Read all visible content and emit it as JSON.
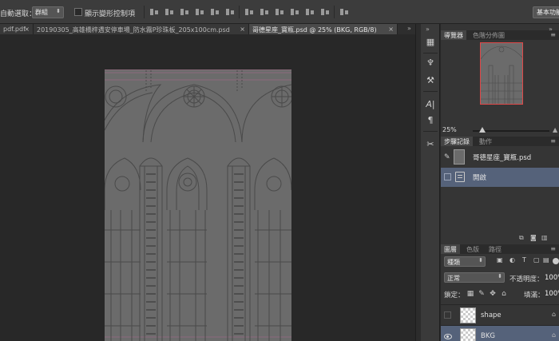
{
  "options_bar": {
    "auto_select_label": "自動選取：",
    "auto_select_value": "群組",
    "show_transform_label": "顯示變形控制項",
    "workspace_value": "基本功能"
  },
  "doc_tabs": [
    {
      "label": "pdf.pdf",
      "active": false
    },
    {
      "label": "20190305_高雄橋梓遇安停車場_防水霧P珍珠板_205x100cm.psd",
      "active": false
    },
    {
      "label": "哥德星座_寶瓶.psd @ 25% (BKG, RGB/8)",
      "active": true
    }
  ],
  "icons": {
    "close": "×",
    "collapse": "»",
    "dropdown": "⬍",
    "panel_menu": "≡"
  },
  "navigator": {
    "tabs": [
      "導覽器",
      "色階分佈圖"
    ],
    "zoom": "25%"
  },
  "history": {
    "tabs": [
      "步驟記錄",
      "動作"
    ],
    "snapshot_label": "哥德星座_寶瓶.psd",
    "states": [
      "開啟"
    ]
  },
  "layers": {
    "tabs": [
      "圖層",
      "色版",
      "路徑"
    ],
    "filter_kind": "種類",
    "blend_mode": "正常",
    "opacity_label": "不透明度：",
    "opacity_value": "100%",
    "lock_label": "鎖定：",
    "fill_label": "填滿：",
    "fill_value": "100%",
    "items": [
      {
        "name": "shape",
        "visible": false,
        "active": false
      },
      {
        "name": "BKG",
        "visible": true,
        "active": true
      }
    ]
  }
}
